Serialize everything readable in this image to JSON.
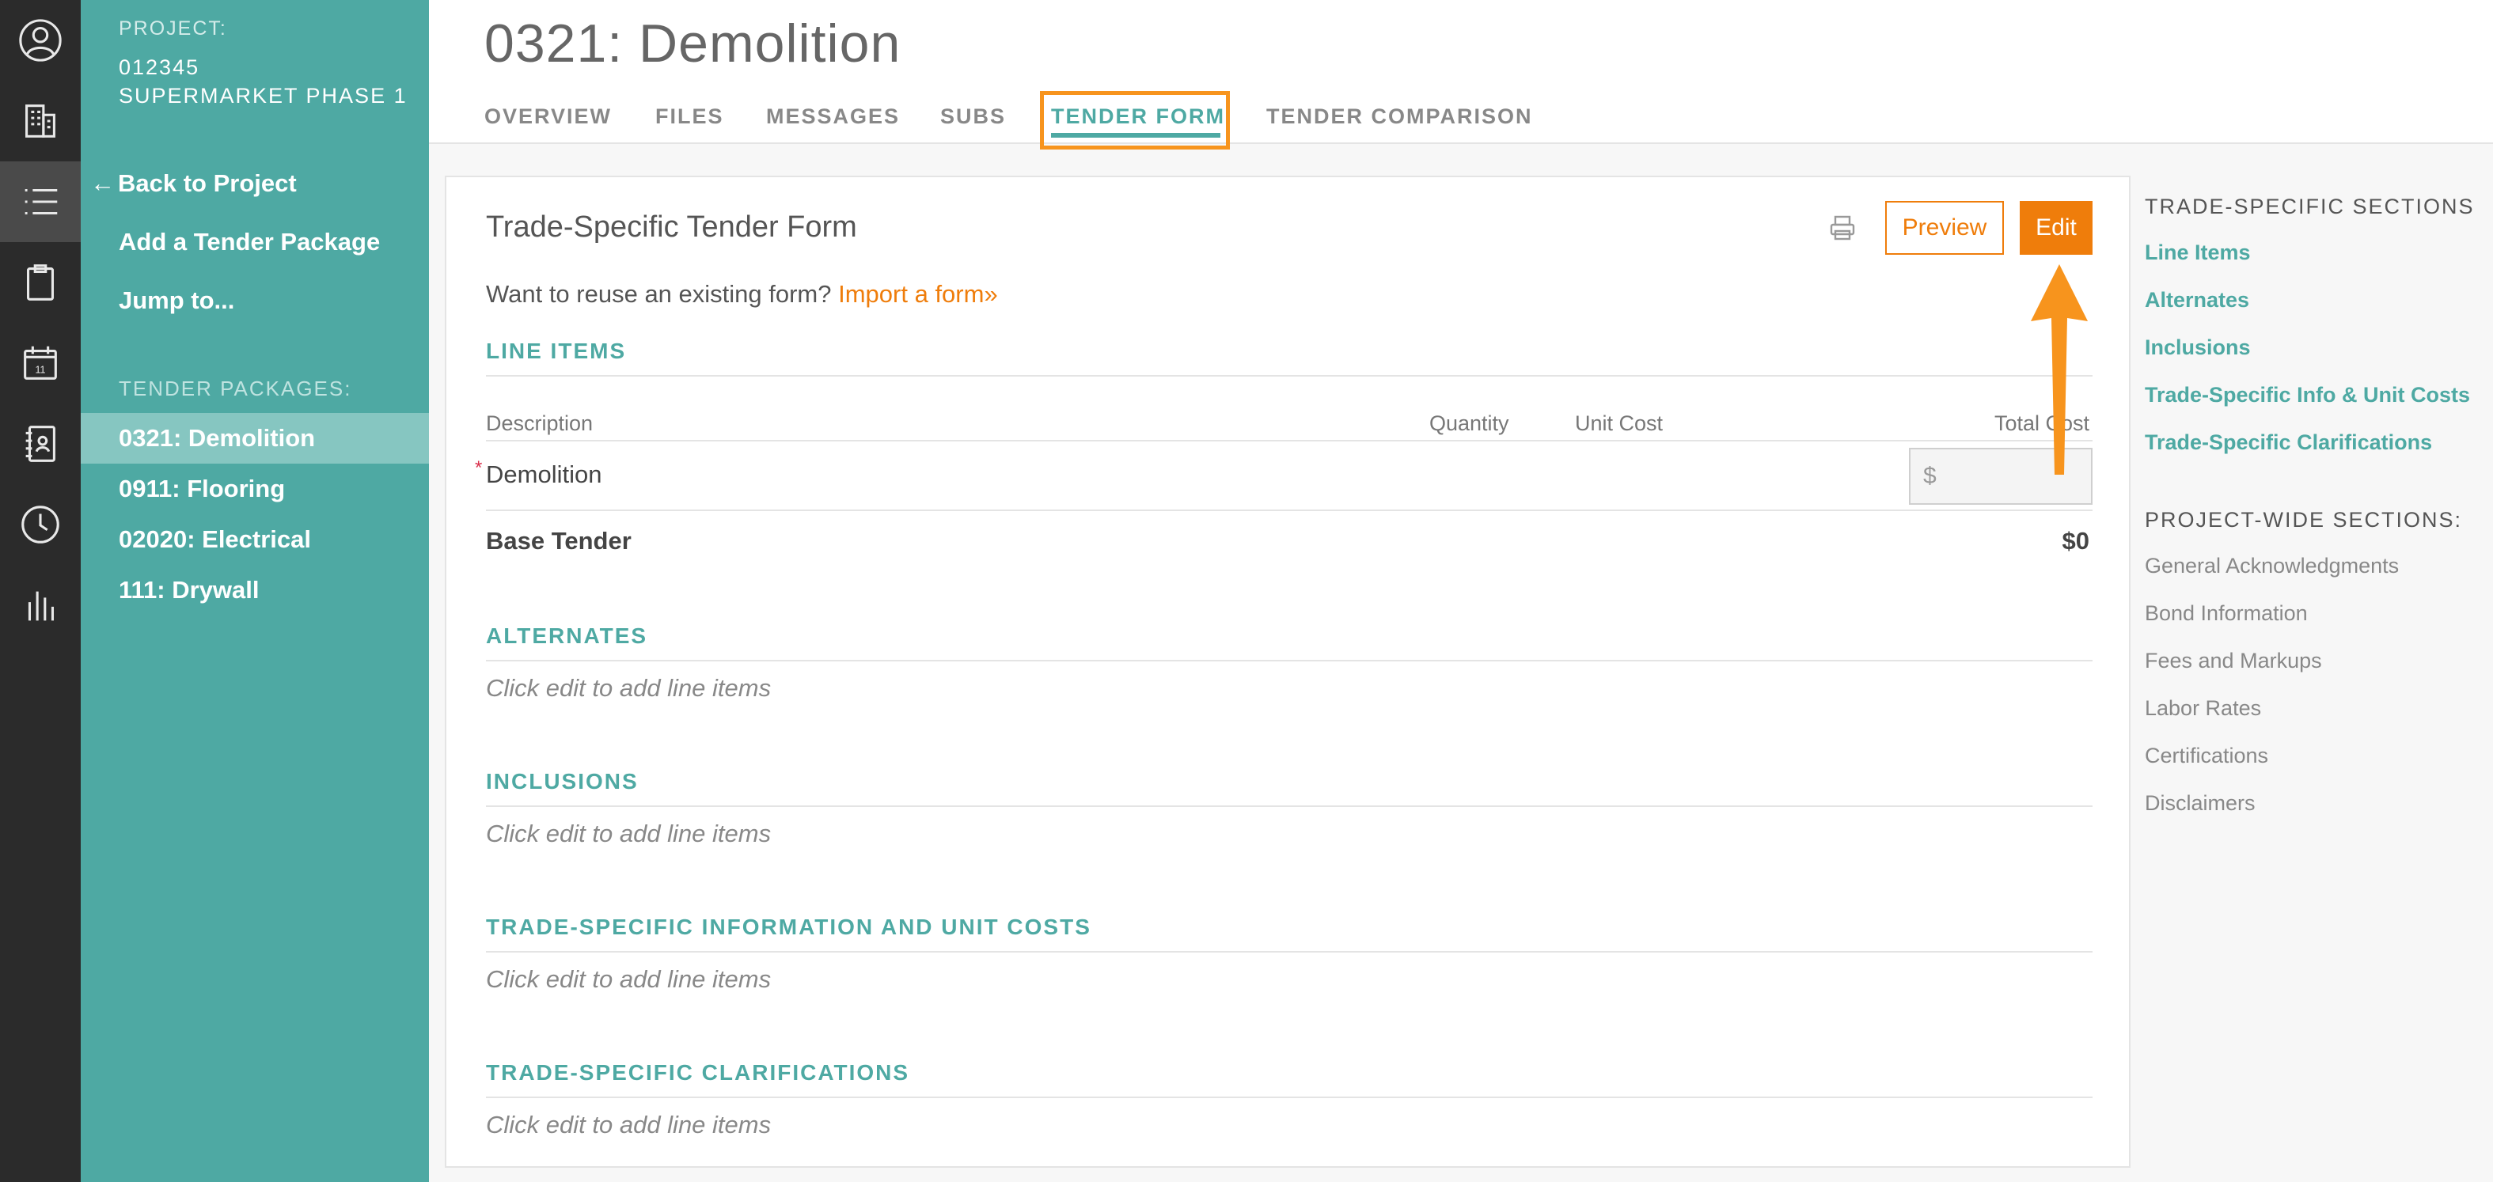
{
  "rail": {
    "items": [
      {
        "name": "user-icon"
      },
      {
        "name": "building-icon"
      },
      {
        "name": "list-icon",
        "active": true
      },
      {
        "name": "clipboard-icon"
      },
      {
        "name": "calendar-icon",
        "text": "11"
      },
      {
        "name": "contacts-icon"
      },
      {
        "name": "clock-icon"
      },
      {
        "name": "bar-chart-icon"
      }
    ]
  },
  "sidebar": {
    "project_label": "PROJECT:",
    "project_number": "012345",
    "project_name": "SUPERMARKET PHASE 1",
    "back_arrow": "←",
    "back_label": "Back to Project",
    "add_package": "Add a Tender Package",
    "jump_to": "Jump to...",
    "packages_label": "TENDER PACKAGES:",
    "packages": [
      {
        "label": "0321: Demolition",
        "active": true
      },
      {
        "label": "0911: Flooring"
      },
      {
        "label": "02020: Electrical"
      },
      {
        "label": "111: Drywall"
      }
    ]
  },
  "header": {
    "title": "0321: Demolition",
    "tabs": [
      {
        "label": "OVERVIEW"
      },
      {
        "label": "FILES"
      },
      {
        "label": "MESSAGES"
      },
      {
        "label": "SUBS"
      },
      {
        "label": "TENDER FORM",
        "active": true
      },
      {
        "label": "TENDER COMPARISON"
      }
    ]
  },
  "form": {
    "title": "Trade-Specific Tender Form",
    "preview_label": "Preview",
    "edit_label": "Edit",
    "reuse_text": "Want to reuse an existing form?",
    "import_link": "Import a form»",
    "line_items": {
      "title": "LINE ITEMS",
      "columns": {
        "description": "Description",
        "quantity": "Quantity",
        "unit_cost": "Unit Cost",
        "total_cost": "Total Cost"
      },
      "rows": [
        {
          "required_mark": "*",
          "description": "Demolition",
          "total_placeholder": "$"
        }
      ],
      "base_label": "Base Tender",
      "base_value": "$0"
    },
    "sections": [
      {
        "title": "ALTERNATES",
        "empty": "Click edit to add line items"
      },
      {
        "title": "INCLUSIONS",
        "empty": "Click edit to add line items"
      },
      {
        "title": "TRADE-SPECIFIC INFORMATION AND UNIT COSTS",
        "empty": "Click edit to add line items"
      },
      {
        "title": "TRADE-SPECIFIC CLARIFICATIONS",
        "empty": "Click edit to add line items"
      }
    ]
  },
  "right_nav": {
    "trade_label": "TRADE-SPECIFIC SECTIONS",
    "trade_items": [
      "Line Items",
      "Alternates",
      "Inclusions",
      "Trade-Specific Info & Unit Costs",
      "Trade-Specific Clarifications"
    ],
    "project_label": "PROJECT-WIDE SECTIONS:",
    "project_items": [
      "General Acknowledgments",
      "Bond Information",
      "Fees and Markups",
      "Labor Rates",
      "Certifications",
      "Disclaimers"
    ]
  },
  "colors": {
    "teal": "#4ea9a3",
    "orange": "#ef7d0b",
    "annotation_orange": "#f7941d",
    "rail": "#2b2b2b"
  }
}
